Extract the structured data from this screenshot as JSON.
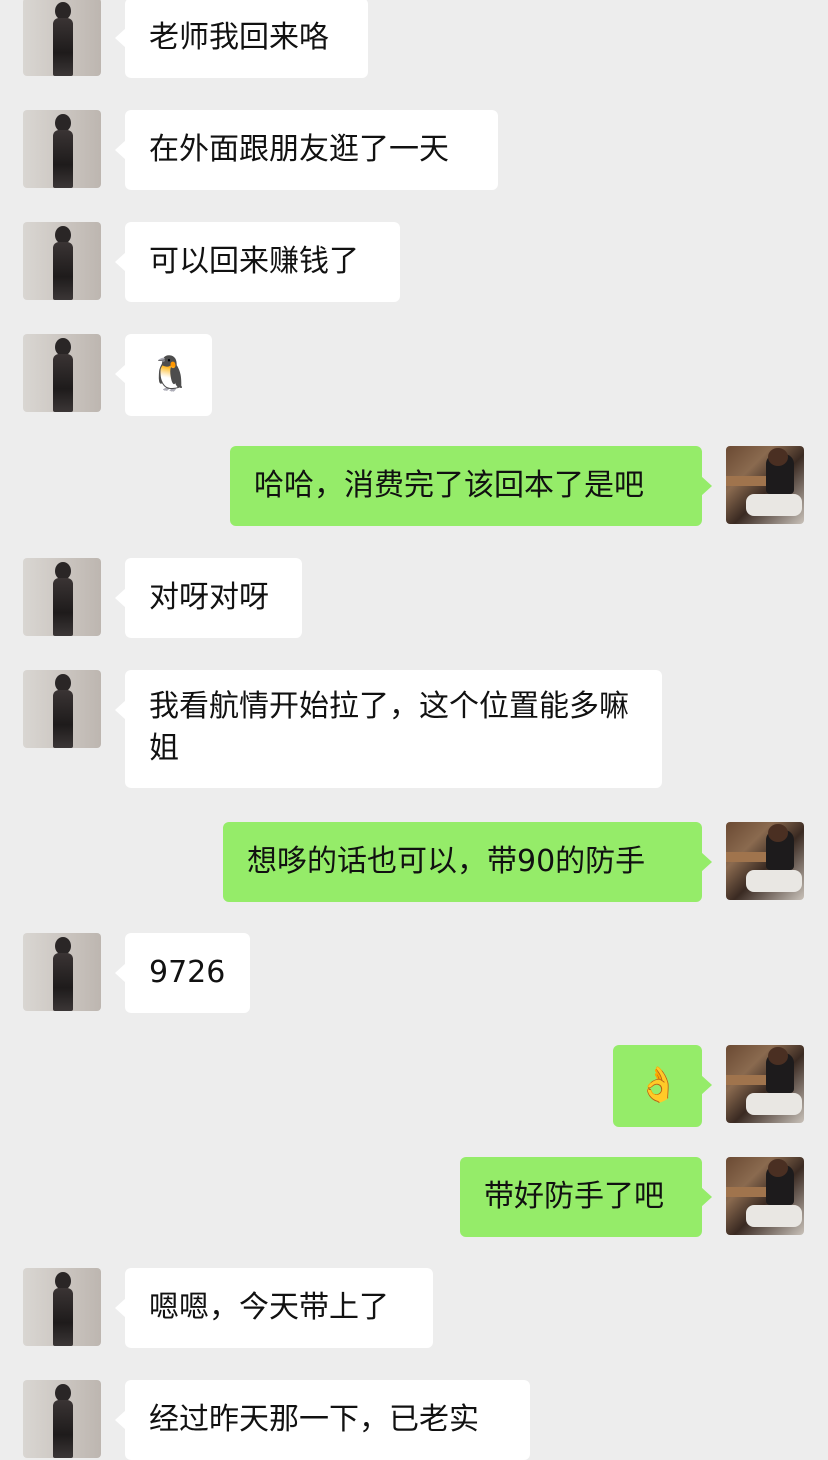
{
  "messages": [
    {
      "side": "in",
      "text": "老师我回来咯"
    },
    {
      "side": "in",
      "text": "在外面跟朋友逛了一天"
    },
    {
      "side": "in",
      "text": "可以回来赚钱了"
    },
    {
      "side": "in",
      "text": "🐧"
    },
    {
      "side": "out",
      "text": "哈哈，消费完了该回本了是吧"
    },
    {
      "side": "in",
      "text": "对呀对呀"
    },
    {
      "side": "in",
      "text": "我看航情开始拉了，这个位置能多嘛姐"
    },
    {
      "side": "out",
      "text": "想哆的话也可以，带90的防手"
    },
    {
      "side": "in",
      "text": "9726"
    },
    {
      "side": "out",
      "text": "👌"
    },
    {
      "side": "out",
      "text": "带好防手了吧"
    },
    {
      "side": "in",
      "text": "嗯嗯，今天带上了"
    },
    {
      "side": "in",
      "text": "经过昨天那一下，已老实"
    }
  ],
  "colors": {
    "background": "#ededed",
    "incoming_bubble": "#ffffff",
    "outgoing_bubble": "#95ec69"
  }
}
